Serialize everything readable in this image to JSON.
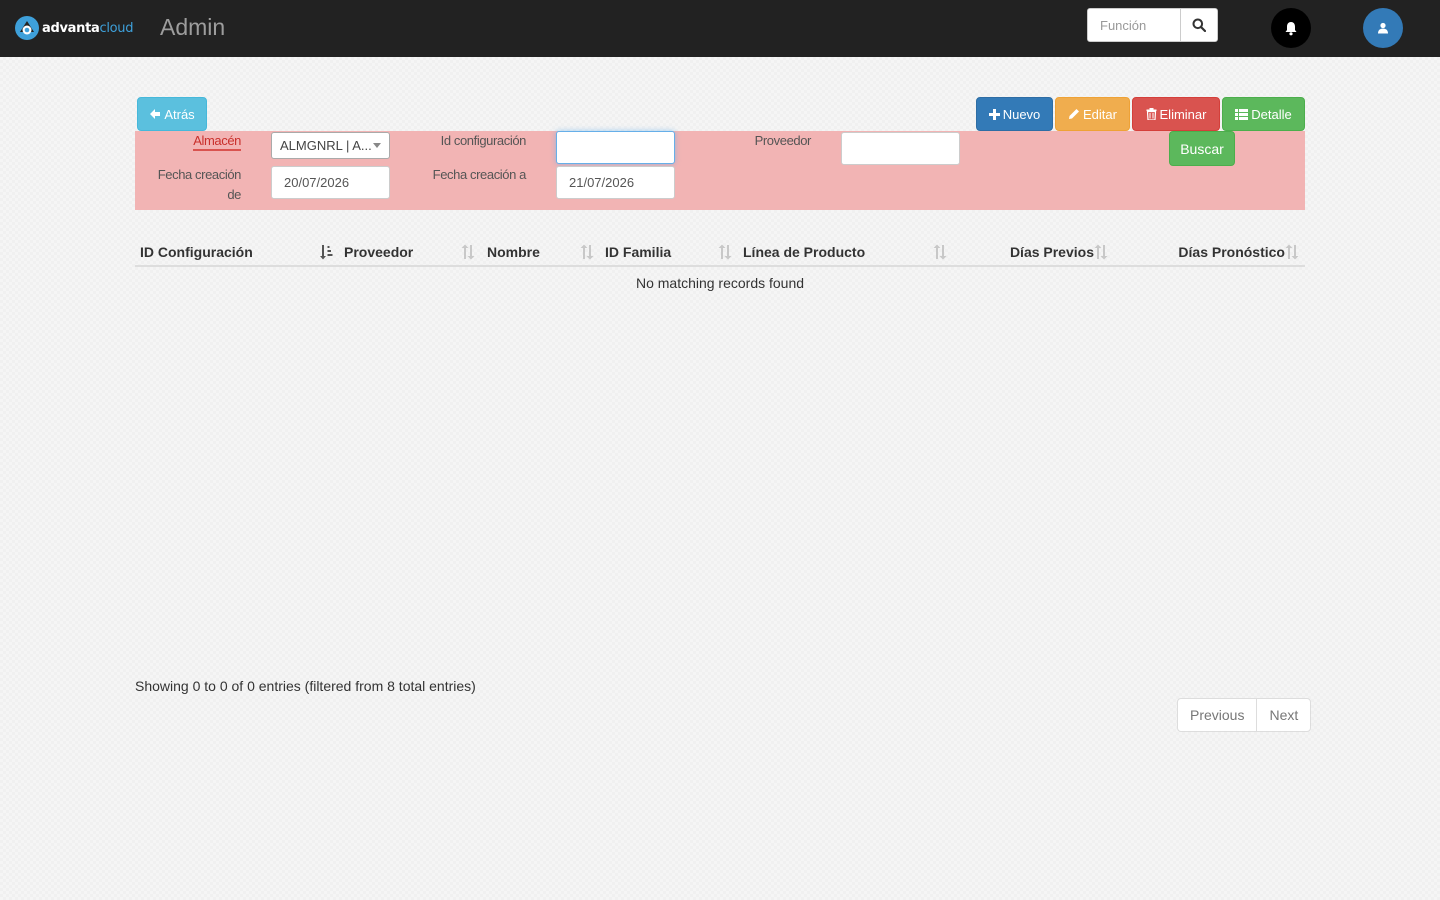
{
  "navbar": {
    "logo_part1": "advanta",
    "logo_part2": "cloud",
    "title": "Admin",
    "search_placeholder": "Función",
    "icons": [
      "search-icon",
      "bell-icon",
      "user-icon"
    ]
  },
  "toolbar": {
    "back_label": "Atrás",
    "new_label": "Nuevo",
    "edit_label": "Editar",
    "delete_label": "Eliminar",
    "detail_label": "Detalle",
    "search_label": "Buscar"
  },
  "filters": {
    "almacen_label": "Almacén",
    "almacen_value": "ALMGNRL | A...",
    "id_config_label": "Id configuración",
    "id_config_value": "",
    "proveedor_label": "Proveedor",
    "proveedor_value": "",
    "fecha_de_label_line1": "Fecha creación",
    "fecha_de_label_line2": "de",
    "fecha_de_value": "20/07/2026",
    "fecha_a_label": "Fecha creación a",
    "fecha_a_value": "21/07/2026"
  },
  "table": {
    "columns": [
      "ID Configuración",
      "Proveedor",
      "Nombre",
      "ID Familia",
      "Línea de Producto",
      "Días Previos",
      "Días Pronóstico"
    ],
    "empty_message": "No matching records found"
  },
  "footer": {
    "info": "Showing 0 to 0 of 0 entries (filtered from 8 total entries)",
    "previous_label": "Previous",
    "next_label": "Next"
  },
  "colors": {
    "navbar": "#222222",
    "filter_panel": "#f2b4b4",
    "primary": "#337ab7",
    "info": "#5bc0de",
    "warning": "#f0ad4e",
    "danger": "#d9534f",
    "success": "#5cb85c"
  }
}
